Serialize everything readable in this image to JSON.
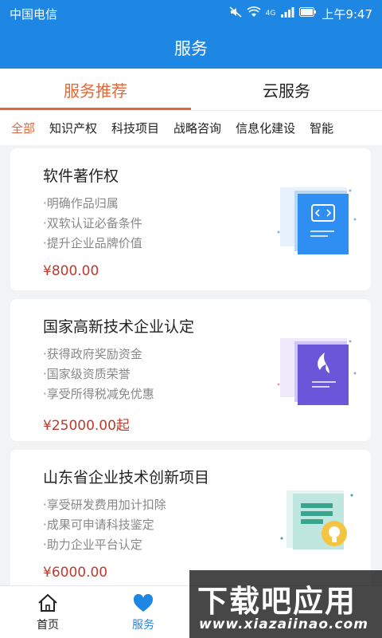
{
  "status_bar": {
    "carrier": "中国电信",
    "time": "上午9:47",
    "net_label": "4G"
  },
  "header": {
    "title": "服务"
  },
  "tabs": [
    {
      "label": "服务推荐"
    },
    {
      "label": "云服务"
    }
  ],
  "categories": [
    "全部",
    "知识产权",
    "科技项目",
    "战略咨询",
    "信息化建设",
    "智能"
  ],
  "cards": [
    {
      "title": "软件著作权",
      "features": [
        "·明确作品归属",
        "·双软认证必备条件",
        "·提升企业品牌价值"
      ],
      "price": "¥800.00",
      "icon": "code-document-icon"
    },
    {
      "title": "国家高新技术企业认定",
      "features": [
        "·获得政府奖励资金",
        "·国家级资质荣誉",
        "·享受所得税减免优惠"
      ],
      "price": "¥25000.00起",
      "icon": "flame-document-icon"
    },
    {
      "title": "山东省企业技术创新项目",
      "features": [
        "·享受研发费用加计扣除",
        "·成果可申请科技鉴定",
        "·助力企业平台认定"
      ],
      "price": "¥6000.00",
      "icon": "lightbulb-document-icon"
    }
  ],
  "bottom_nav": [
    {
      "label": "首页",
      "icon": "home-icon"
    },
    {
      "label": "服务",
      "icon": "heart-icon"
    }
  ],
  "watermark": {
    "main": "下载吧应用",
    "sub": "www.xiazaiinao.com"
  },
  "colors": {
    "primary": "#1e87e4",
    "accent": "#e0683b",
    "price": "#c0392b"
  }
}
